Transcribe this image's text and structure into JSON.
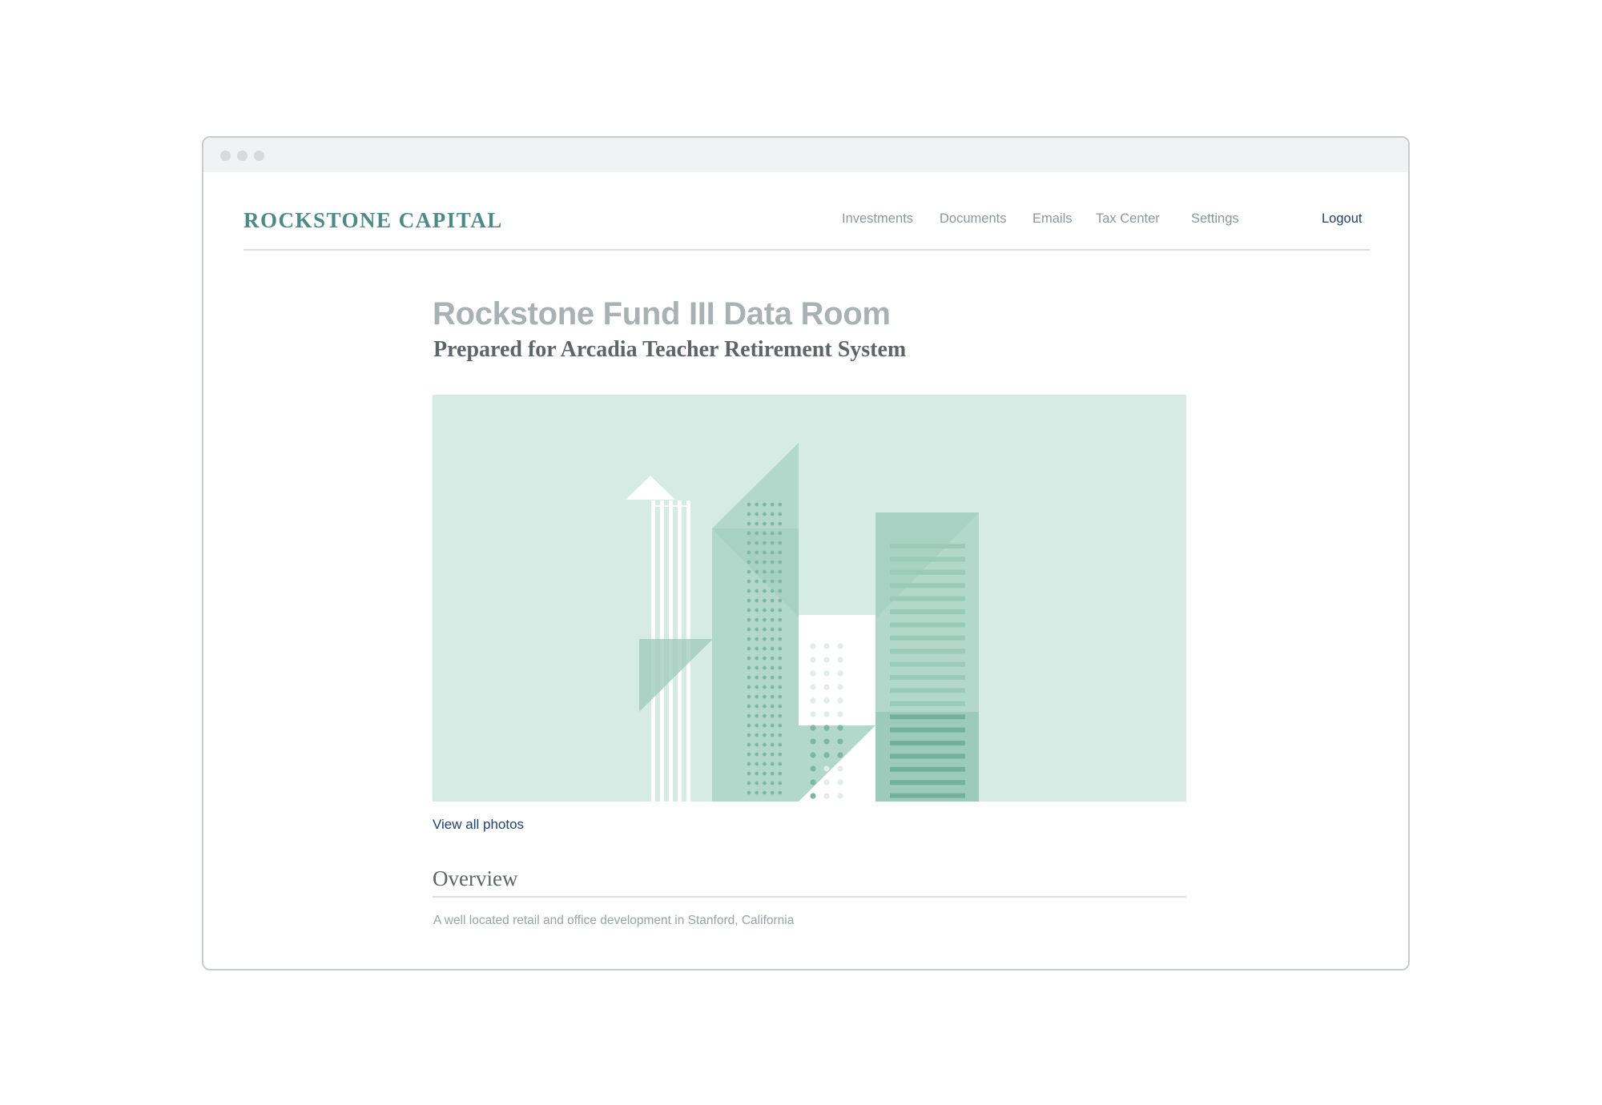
{
  "brand": {
    "logo_text": "ROCKSTONE CAPITAL",
    "accent": "#4b8a86"
  },
  "nav": {
    "items": [
      {
        "label": "Investments"
      },
      {
        "label": "Documents"
      },
      {
        "label": "Emails"
      },
      {
        "label": "Tax Center"
      },
      {
        "label": "Settings"
      },
      {
        "label": "Logout"
      }
    ]
  },
  "main": {
    "title": "Rockstone Fund III Data Room",
    "subtitle": "Prepared for Arcadia Teacher Retirement System",
    "hero": {
      "icon": "city-skyline-illustration"
    },
    "view_photos_label": "View all photos",
    "overview": {
      "heading": "Overview",
      "text": "A well located retail and office development in Stanford, California"
    }
  },
  "colors": {
    "title": "#a9b1b3",
    "link": "#1f3f6a",
    "nav": "#8d979b",
    "hero_bg": "#d6ebe4",
    "hero_green": "#b2d7cb",
    "hero_dark": "#7fb5a3"
  }
}
